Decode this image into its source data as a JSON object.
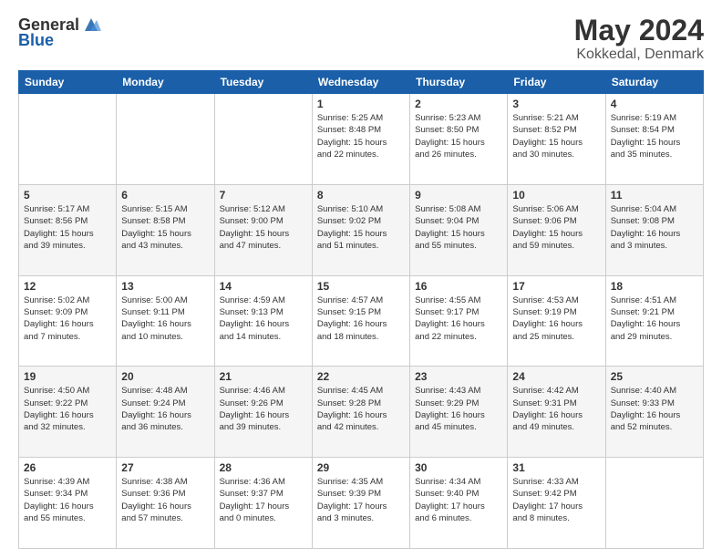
{
  "header": {
    "logo_general": "General",
    "logo_blue": "Blue",
    "month": "May 2024",
    "location": "Kokkedal, Denmark"
  },
  "weekdays": [
    "Sunday",
    "Monday",
    "Tuesday",
    "Wednesday",
    "Thursday",
    "Friday",
    "Saturday"
  ],
  "weeks": [
    [
      {
        "day": "",
        "info": ""
      },
      {
        "day": "",
        "info": ""
      },
      {
        "day": "",
        "info": ""
      },
      {
        "day": "1",
        "info": "Sunrise: 5:25 AM\nSunset: 8:48 PM\nDaylight: 15 hours\nand 22 minutes."
      },
      {
        "day": "2",
        "info": "Sunrise: 5:23 AM\nSunset: 8:50 PM\nDaylight: 15 hours\nand 26 minutes."
      },
      {
        "day": "3",
        "info": "Sunrise: 5:21 AM\nSunset: 8:52 PM\nDaylight: 15 hours\nand 30 minutes."
      },
      {
        "day": "4",
        "info": "Sunrise: 5:19 AM\nSunset: 8:54 PM\nDaylight: 15 hours\nand 35 minutes."
      }
    ],
    [
      {
        "day": "5",
        "info": "Sunrise: 5:17 AM\nSunset: 8:56 PM\nDaylight: 15 hours\nand 39 minutes."
      },
      {
        "day": "6",
        "info": "Sunrise: 5:15 AM\nSunset: 8:58 PM\nDaylight: 15 hours\nand 43 minutes."
      },
      {
        "day": "7",
        "info": "Sunrise: 5:12 AM\nSunset: 9:00 PM\nDaylight: 15 hours\nand 47 minutes."
      },
      {
        "day": "8",
        "info": "Sunrise: 5:10 AM\nSunset: 9:02 PM\nDaylight: 15 hours\nand 51 minutes."
      },
      {
        "day": "9",
        "info": "Sunrise: 5:08 AM\nSunset: 9:04 PM\nDaylight: 15 hours\nand 55 minutes."
      },
      {
        "day": "10",
        "info": "Sunrise: 5:06 AM\nSunset: 9:06 PM\nDaylight: 15 hours\nand 59 minutes."
      },
      {
        "day": "11",
        "info": "Sunrise: 5:04 AM\nSunset: 9:08 PM\nDaylight: 16 hours\nand 3 minutes."
      }
    ],
    [
      {
        "day": "12",
        "info": "Sunrise: 5:02 AM\nSunset: 9:09 PM\nDaylight: 16 hours\nand 7 minutes."
      },
      {
        "day": "13",
        "info": "Sunrise: 5:00 AM\nSunset: 9:11 PM\nDaylight: 16 hours\nand 10 minutes."
      },
      {
        "day": "14",
        "info": "Sunrise: 4:59 AM\nSunset: 9:13 PM\nDaylight: 16 hours\nand 14 minutes."
      },
      {
        "day": "15",
        "info": "Sunrise: 4:57 AM\nSunset: 9:15 PM\nDaylight: 16 hours\nand 18 minutes."
      },
      {
        "day": "16",
        "info": "Sunrise: 4:55 AM\nSunset: 9:17 PM\nDaylight: 16 hours\nand 22 minutes."
      },
      {
        "day": "17",
        "info": "Sunrise: 4:53 AM\nSunset: 9:19 PM\nDaylight: 16 hours\nand 25 minutes."
      },
      {
        "day": "18",
        "info": "Sunrise: 4:51 AM\nSunset: 9:21 PM\nDaylight: 16 hours\nand 29 minutes."
      }
    ],
    [
      {
        "day": "19",
        "info": "Sunrise: 4:50 AM\nSunset: 9:22 PM\nDaylight: 16 hours\nand 32 minutes."
      },
      {
        "day": "20",
        "info": "Sunrise: 4:48 AM\nSunset: 9:24 PM\nDaylight: 16 hours\nand 36 minutes."
      },
      {
        "day": "21",
        "info": "Sunrise: 4:46 AM\nSunset: 9:26 PM\nDaylight: 16 hours\nand 39 minutes."
      },
      {
        "day": "22",
        "info": "Sunrise: 4:45 AM\nSunset: 9:28 PM\nDaylight: 16 hours\nand 42 minutes."
      },
      {
        "day": "23",
        "info": "Sunrise: 4:43 AM\nSunset: 9:29 PM\nDaylight: 16 hours\nand 45 minutes."
      },
      {
        "day": "24",
        "info": "Sunrise: 4:42 AM\nSunset: 9:31 PM\nDaylight: 16 hours\nand 49 minutes."
      },
      {
        "day": "25",
        "info": "Sunrise: 4:40 AM\nSunset: 9:33 PM\nDaylight: 16 hours\nand 52 minutes."
      }
    ],
    [
      {
        "day": "26",
        "info": "Sunrise: 4:39 AM\nSunset: 9:34 PM\nDaylight: 16 hours\nand 55 minutes."
      },
      {
        "day": "27",
        "info": "Sunrise: 4:38 AM\nSunset: 9:36 PM\nDaylight: 16 hours\nand 57 minutes."
      },
      {
        "day": "28",
        "info": "Sunrise: 4:36 AM\nSunset: 9:37 PM\nDaylight: 17 hours\nand 0 minutes."
      },
      {
        "day": "29",
        "info": "Sunrise: 4:35 AM\nSunset: 9:39 PM\nDaylight: 17 hours\nand 3 minutes."
      },
      {
        "day": "30",
        "info": "Sunrise: 4:34 AM\nSunset: 9:40 PM\nDaylight: 17 hours\nand 6 minutes."
      },
      {
        "day": "31",
        "info": "Sunrise: 4:33 AM\nSunset: 9:42 PM\nDaylight: 17 hours\nand 8 minutes."
      },
      {
        "day": "",
        "info": ""
      }
    ]
  ]
}
